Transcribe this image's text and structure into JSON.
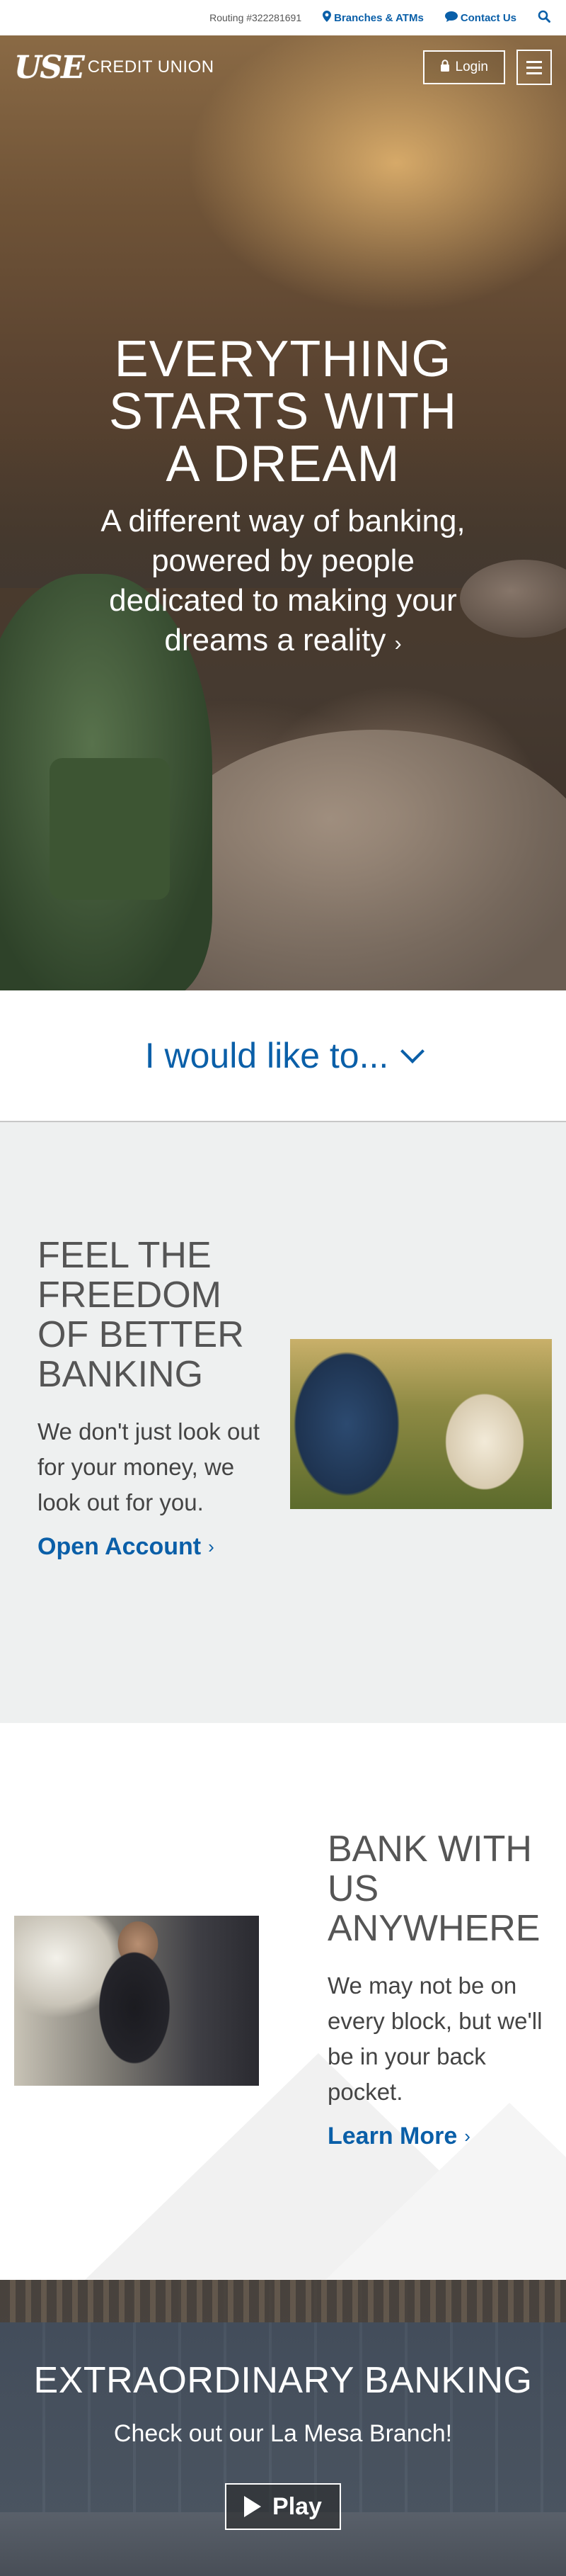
{
  "utility_bar": {
    "routing": "Routing #322281691",
    "branches_label": "Branches & ATMs",
    "contact_label": "Contact Us"
  },
  "header": {
    "logo_mark": "USE",
    "logo_text": "CREDIT UNION",
    "login_label": "Login"
  },
  "hero": {
    "headline": "EVERYTHING STARTS WITH A DREAM",
    "lede": "A different way of banking, powered by people dedicated to making your dreams a reality",
    "lede_arrow": "›"
  },
  "would_like": {
    "label": "I would like to..."
  },
  "freedom": {
    "title": "FEEL THE FREEDOM OF BETTER BANKING",
    "body": "We don't just look out for your money, we look out for you.",
    "link": "Open Account",
    "link_arrow": "›"
  },
  "anywhere": {
    "title": "BANK WITH US ANYWHERE",
    "body": "We may not be on every block, but we'll be in your back pocket.",
    "link": "Learn More",
    "link_arrow": "›"
  },
  "extraordinary": {
    "title": "EXTRAORDINARY BANKING",
    "subtitle": "Check out our La Mesa Branch!",
    "play_label": "Play"
  },
  "colors": {
    "brand_blue": "#0a5fa8",
    "section_gray": "#eef0f0"
  },
  "icons": [
    "map-pin-icon",
    "chat-bubble-icon",
    "search-icon",
    "lock-icon",
    "hamburger-menu-icon",
    "chevron-down-icon",
    "play-icon"
  ]
}
